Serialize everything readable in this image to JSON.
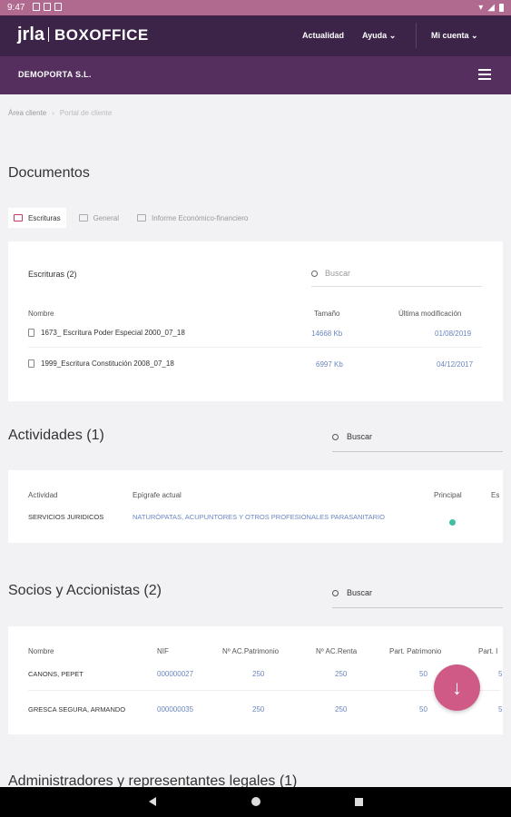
{
  "status_bar": {
    "time": "9:47"
  },
  "topnav": {
    "logo_main": "jrla",
    "logo_product": "BOXOFFICE",
    "links": [
      "Actualidad",
      "Ayuda",
      "Mi cuenta"
    ]
  },
  "company": {
    "name": "DEMOPORTA S.L."
  },
  "breadcrumb": {
    "items": [
      "Área cliente",
      "Portal de cliente"
    ]
  },
  "documentos": {
    "title": "Documentos",
    "tabs": [
      "Escrituras",
      "General",
      "Informe Económico-financiero"
    ],
    "card_title": "Escrituras (2)",
    "search_placeholder": "Buscar",
    "columns": [
      "Nombre",
      "Tamaño",
      "Última modificación"
    ],
    "rows": [
      {
        "name": "1673_ Escritura Poder Especial 2000_07_18",
        "size": "14668 Kb",
        "date": "01/08/2019"
      },
      {
        "name": "1999_Escritura Constitución 2008_07_18",
        "size": "6997 Kb",
        "date": "04/12/2017"
      }
    ]
  },
  "actividades": {
    "title": "Actividades (1)",
    "search_placeholder": "Buscar",
    "columns": [
      "Actividad",
      "Epígrafe actual",
      "Principal",
      "Es"
    ],
    "rows": [
      {
        "actividad": "SERVICIOS JURIDICOS",
        "epigrafe": "NATURÓPATAS, ACUPUNTORES Y OTROS PROFESIONALES PARASANITARIO"
      }
    ]
  },
  "socios": {
    "title": "Socios y Accionistas (2)",
    "search_placeholder": "Buscar",
    "columns": [
      "Nombre",
      "NIF",
      "Nº AC.Patrimonio",
      "Nº AC.Renta",
      "Part. Patrimonio",
      "Part. I"
    ],
    "rows": [
      {
        "nombre": "CANONS, PEPET",
        "nif": "000000027",
        "ac_patrimonio": "250",
        "ac_renta": "250",
        "part_patrimonio": "50",
        "part_r": "5"
      },
      {
        "nombre": "GRESCA SEGURA, ARMANDO",
        "nif": "000000035",
        "ac_patrimonio": "250",
        "ac_renta": "250",
        "part_patrimonio": "50",
        "part_r": "5"
      }
    ]
  },
  "administradores": {
    "title": "Administradores y representantes legales (1)"
  },
  "colors": {
    "accent": "#cf5a86",
    "header": "#3b2447",
    "subheader": "#55305f",
    "link": "#6a86c0"
  }
}
